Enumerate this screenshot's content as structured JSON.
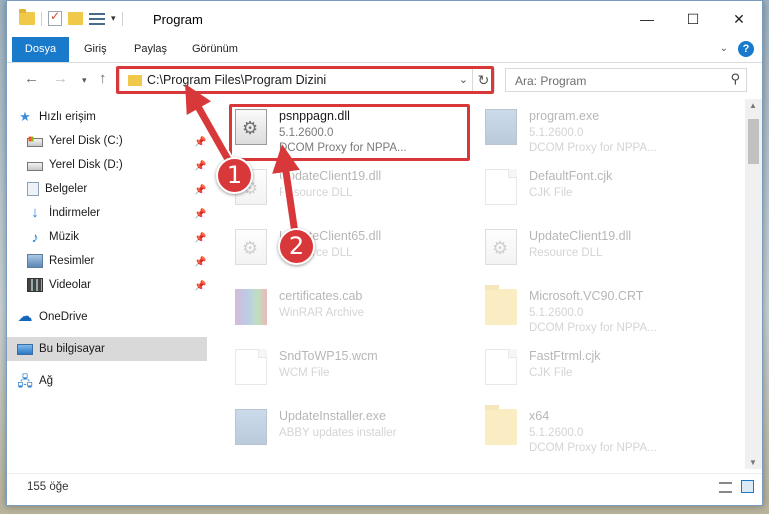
{
  "window": {
    "title": "Program",
    "controls": {
      "minimize": "—",
      "maximize": "☐",
      "close": "✕"
    }
  },
  "ribbon": {
    "tabs": [
      "Dosya",
      "Giriş",
      "Paylaş",
      "Görünüm"
    ]
  },
  "address": {
    "path": "C:\\Program Files\\Program Dizini"
  },
  "search": {
    "placeholder": "Ara: Program"
  },
  "sidebar": {
    "items": [
      {
        "label": "Hızlı erişim",
        "icon": "star-icon"
      },
      {
        "label": "Yerel Disk (C:)",
        "icon": "drive-icon"
      },
      {
        "label": "Yerel Disk (D:)",
        "icon": "drive-icon"
      },
      {
        "label": "Belgeler",
        "icon": "documents-icon"
      },
      {
        "label": "İndirmeler",
        "icon": "download-icon"
      },
      {
        "label": "Müzik",
        "icon": "music-icon"
      },
      {
        "label": "Resimler",
        "icon": "pictures-icon"
      },
      {
        "label": "Videolar",
        "icon": "videos-icon"
      },
      {
        "label": "OneDrive",
        "icon": "cloud-icon"
      },
      {
        "label": "Bu bilgisayar",
        "icon": "computer-icon"
      },
      {
        "label": "Ağ",
        "icon": "network-icon"
      }
    ]
  },
  "files": [
    {
      "name": "psnppagn.dll",
      "l2": "5.1.2600.0",
      "l3": "DCOM Proxy for NPPA...",
      "icon": "dll-file-icon"
    },
    {
      "name": "program.exe",
      "l2": "5.1.2600.0",
      "l3": "DCOM Proxy for NPPA...",
      "icon": "exe-file-icon"
    },
    {
      "name": "UpdateClient19.dll",
      "l2": "Resource DLL",
      "l3": "",
      "icon": "dll-file-icon"
    },
    {
      "name": "DefaultFont.cjk",
      "l2": "CJK File",
      "l3": "",
      "icon": "file-icon"
    },
    {
      "name": "UpdateClient65.dll",
      "l2": "Resource DLL",
      "l3": "",
      "icon": "dll-file-icon"
    },
    {
      "name": "UpdateClient19.dll",
      "l2": "Resource DLL",
      "l3": "",
      "icon": "dll-file-icon"
    },
    {
      "name": "certificates.cab",
      "l2": "WinRAR Archive",
      "l3": "",
      "icon": "archive-icon"
    },
    {
      "name": "Microsoft.VC90.CRT",
      "l2": "5.1.2600.0",
      "l3": "DCOM Proxy for NPPA...",
      "icon": "folder-icon"
    },
    {
      "name": "SndToWP15.wcm",
      "l2": "WCM File",
      "l3": "",
      "icon": "file-icon"
    },
    {
      "name": "FastFtrml.cjk",
      "l2": "CJK File",
      "l3": "",
      "icon": "file-icon"
    },
    {
      "name": "UpdateInstaller.exe",
      "l2": "ABBY updates installer",
      "l3": "",
      "icon": "exe-file-icon"
    },
    {
      "name": "x64",
      "l2": "5.1.2600.0",
      "l3": "DCOM Proxy for NPPA...",
      "icon": "folder-icon"
    }
  ],
  "status": {
    "count": "155 öğe"
  },
  "callouts": [
    "1",
    "2"
  ],
  "colors": {
    "accent": "#1979ca",
    "highlight": "#d9383a"
  }
}
